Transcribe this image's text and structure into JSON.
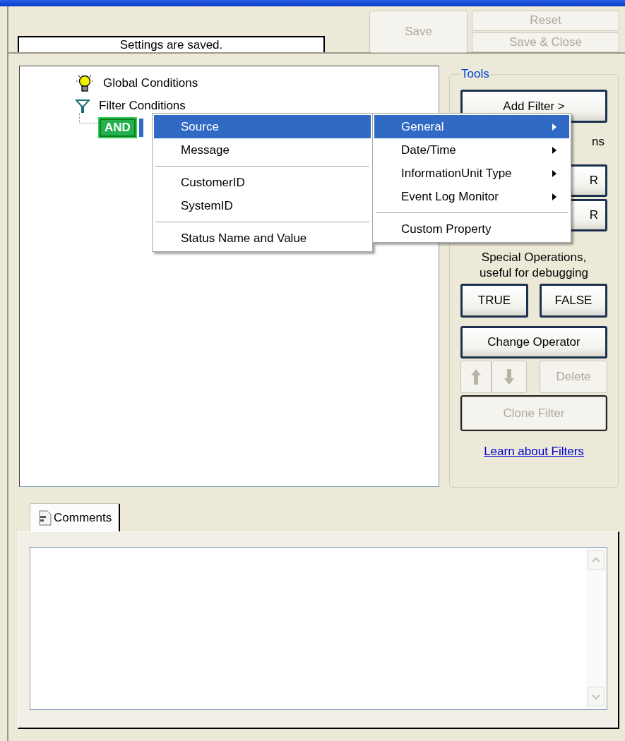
{
  "status_message": "Settings are saved.",
  "header_buttons": [
    {
      "label": "Save",
      "kind": "save",
      "disabled": true
    },
    {
      "label": "Reset",
      "kind": "reset",
      "disabled": true
    },
    {
      "label": "Save & Close",
      "kind": "save_close",
      "disabled": true
    }
  ],
  "tree": [
    {
      "label": "Global Conditions",
      "kind": "global"
    },
    {
      "label": "Filter Conditions",
      "kind": "filter",
      "children": [
        {
          "label": "AND",
          "kind": "operator",
          "selected": true
        }
      ]
    }
  ],
  "context_menu": [
    {
      "kind": "item",
      "label": "Source",
      "selected": true
    },
    {
      "kind": "item",
      "label": "Message",
      "selected": false
    },
    {
      "kind": "separator"
    },
    {
      "kind": "item",
      "label": "CustomerID",
      "selected": false
    },
    {
      "kind": "item",
      "label": "SystemID",
      "selected": false
    },
    {
      "kind": "separator"
    },
    {
      "kind": "item",
      "label": "Status Name and Value",
      "selected": false
    }
  ],
  "submenu": [
    {
      "kind": "item",
      "label": "General",
      "selected": true,
      "has_submenu": true
    },
    {
      "kind": "item",
      "label": "Date/Time",
      "selected": false,
      "has_submenu": true
    },
    {
      "kind": "item",
      "label": "InformationUnit Type",
      "selected": false,
      "has_submenu": true
    },
    {
      "kind": "item",
      "label": "Event Log Monitor",
      "selected": false,
      "has_submenu": true
    },
    {
      "kind": "separator"
    },
    {
      "kind": "item",
      "label": "Custom Property",
      "selected": false,
      "has_submenu": false
    }
  ],
  "tools": {
    "title": "Tools",
    "add_filter": {
      "label": "Add Filter >",
      "disabled": false
    },
    "hidden_caption": "ns",
    "operator_buttons": [
      {
        "label": "R",
        "disabled": false
      },
      {
        "label": "R",
        "disabled": false
      }
    ],
    "special_caption": "Special Operations,",
    "special_note": "useful for debugging",
    "constant_buttons": [
      {
        "label": "TRUE",
        "disabled": false
      },
      {
        "label": "FALSE",
        "disabled": false
      }
    ],
    "change_operator": {
      "label": "Change Operator",
      "disabled": false
    },
    "move_up": {
      "disabled": true
    },
    "move_down": {
      "disabled": true
    },
    "delete": {
      "label": "Delete",
      "disabled": true
    },
    "clone": {
      "label": "Clone Filter",
      "disabled": true
    },
    "link": "Learn about Filters"
  },
  "comments_tab": {
    "label": "Comments",
    "selected": true
  }
}
